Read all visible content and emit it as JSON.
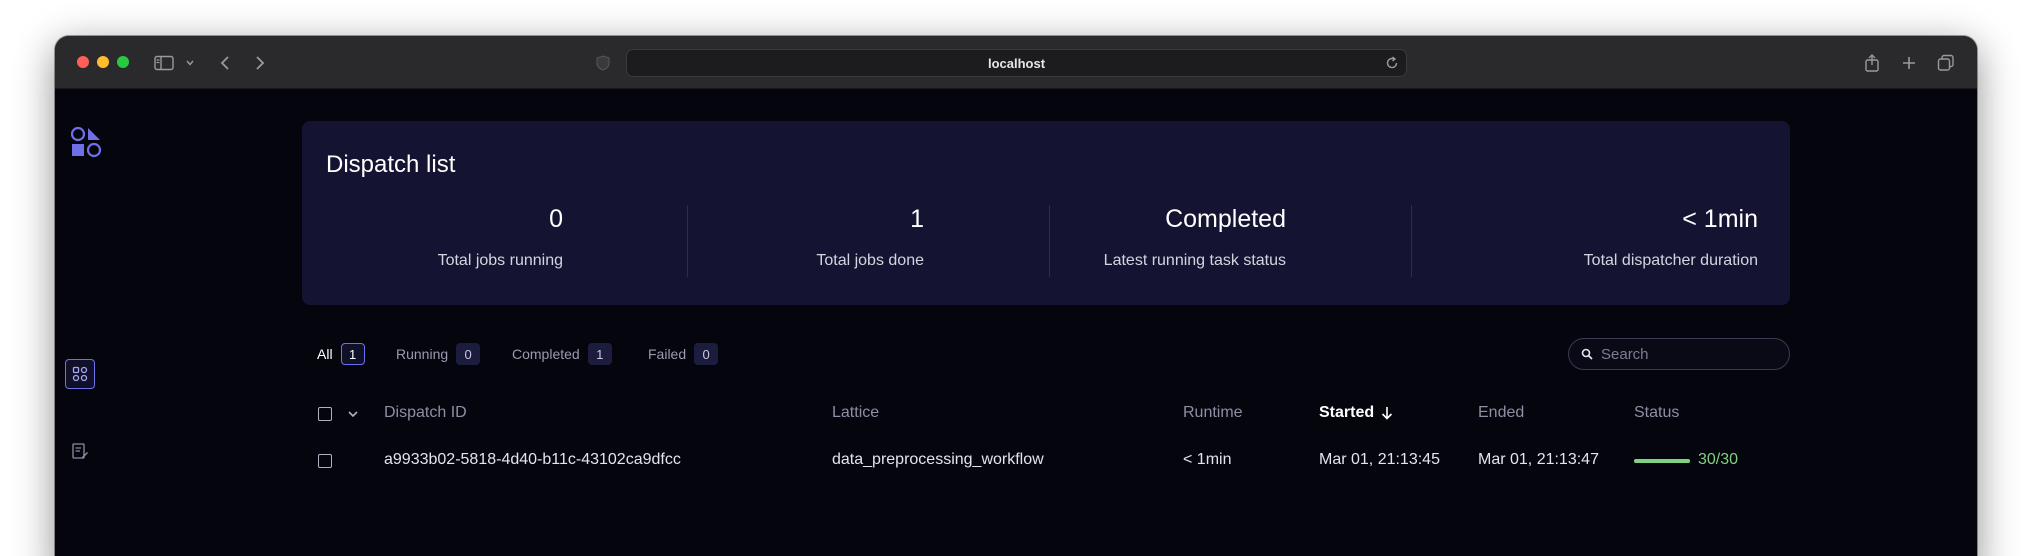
{
  "browser": {
    "url": "localhost",
    "colors": {
      "close": "#ff5f57",
      "minimize": "#febc2e",
      "zoom": "#28c840"
    }
  },
  "header": {
    "title": "Dispatch list"
  },
  "stats": [
    {
      "value": "0",
      "label": "Total jobs running"
    },
    {
      "value": "1",
      "label": "Total jobs done"
    },
    {
      "value": "Completed",
      "label": "Latest running task status"
    },
    {
      "value": "< 1min",
      "label": "Total dispatcher duration"
    }
  ],
  "filters": [
    {
      "label": "All",
      "count": "1",
      "active": true
    },
    {
      "label": "Running",
      "count": "0",
      "active": false
    },
    {
      "label": "Completed",
      "count": "1",
      "active": false
    },
    {
      "label": "Failed",
      "count": "0",
      "active": false
    }
  ],
  "search": {
    "placeholder": "Search"
  },
  "table": {
    "columns": {
      "dispatch_id": "Dispatch ID",
      "lattice": "Lattice",
      "runtime": "Runtime",
      "started": "Started",
      "ended": "Ended",
      "status": "Status"
    },
    "sort": {
      "column": "started",
      "direction": "descending"
    },
    "rows": [
      {
        "dispatch_id": "a9933b02-5818-4d40-b11c-43102ca9dfcc",
        "lattice": "data_preprocessing_workflow",
        "runtime": "< 1min",
        "started": "Mar 01, 21:13:45",
        "ended": "Mar 01, 21:13:47",
        "status": "30/30",
        "progress": 1.0
      }
    ]
  },
  "theme": {
    "accent": "#6f6fe8",
    "success": "#7fd27f",
    "panel_bg": "#141432"
  }
}
